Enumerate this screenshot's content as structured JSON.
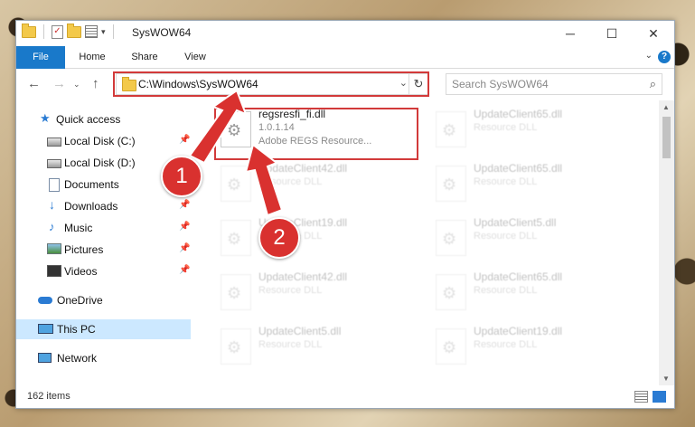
{
  "window": {
    "title": "SysWOW64"
  },
  "ribbon": {
    "tabs": [
      "File",
      "Home",
      "Share",
      "View"
    ]
  },
  "nav": {
    "address": "C:\\Windows\\SysWOW64",
    "search_placeholder": "Search SysWOW64"
  },
  "sidebar": {
    "items": [
      {
        "label": "Quick access",
        "icon": "star-icon",
        "pinned": false
      },
      {
        "label": "Local Disk (C:)",
        "icon": "drive-icon",
        "pinned": true
      },
      {
        "label": "Local Disk (D:)",
        "icon": "drive-icon",
        "pinned": false
      },
      {
        "label": "Documents",
        "icon": "documents-icon",
        "pinned": true
      },
      {
        "label": "Downloads",
        "icon": "download-icon",
        "pinned": true
      },
      {
        "label": "Music",
        "icon": "music-icon",
        "pinned": true
      },
      {
        "label": "Pictures",
        "icon": "pictures-icon",
        "pinned": true
      },
      {
        "label": "Videos",
        "icon": "videos-icon",
        "pinned": true
      },
      {
        "label": "OneDrive",
        "icon": "onedrive-icon",
        "pinned": false
      },
      {
        "label": "This PC",
        "icon": "pc-icon",
        "pinned": false,
        "selected": true
      },
      {
        "label": "Network",
        "icon": "network-icon",
        "pinned": false
      }
    ]
  },
  "files": [
    {
      "name": "regsresfi_fi.dll",
      "line2": "1.0.1.14",
      "line3": "Adobe REGS Resource...",
      "highlighted": true
    },
    {
      "name": "UpdateClient65.dll",
      "line2": "Resource DLL"
    },
    {
      "name": "UpdateClient42.dll",
      "line2": "Resource DLL"
    },
    {
      "name": "UpdateClient65.dll",
      "line2": "Resource DLL"
    },
    {
      "name": "UpdateClient19.dll",
      "line2": "Resource DLL"
    },
    {
      "name": "UpdateClient5.dll",
      "line2": "Resource DLL"
    },
    {
      "name": "UpdateClient42.dll",
      "line2": "Resource DLL"
    },
    {
      "name": "UpdateClient65.dll",
      "line2": "Resource DLL"
    },
    {
      "name": "UpdateClient5.dll",
      "line2": "Resource DLL"
    },
    {
      "name": "UpdateClient19.dll",
      "line2": "Resource DLL"
    }
  ],
  "status": {
    "item_count": "162 items"
  },
  "annotations": {
    "step1": "1",
    "step2": "2"
  },
  "colors": {
    "accent": "#1979ca",
    "highlight": "#d23a3a",
    "selection": "#cce8ff"
  }
}
